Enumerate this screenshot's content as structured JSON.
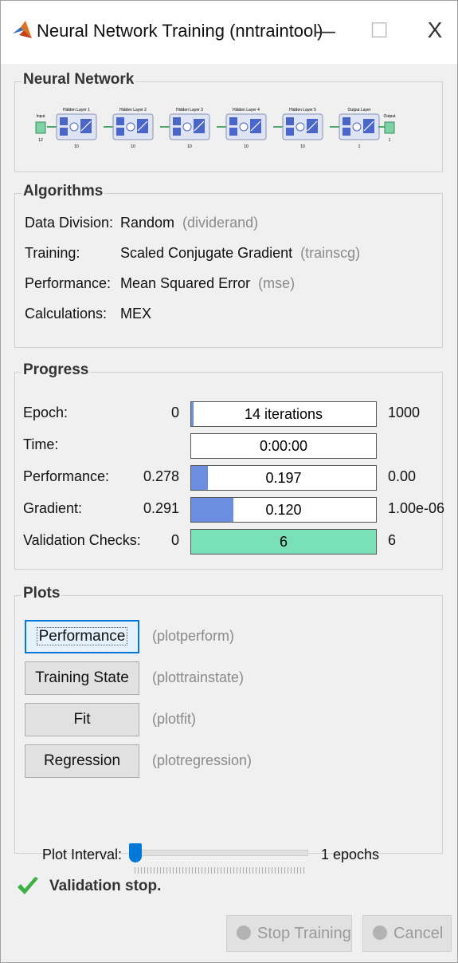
{
  "window": {
    "title": "Neural Network Training (nntraintool)",
    "minimize_glyph": "—",
    "maximize_glyph": "☐",
    "close_glyph": "X",
    "icon": "matlab-logo-icon"
  },
  "network": {
    "title": "Neural Network",
    "input_label": "Input",
    "input_size": "12",
    "output_label": "Output",
    "output_size": "1",
    "layers": [
      {
        "name": "Hidden Layer 1",
        "size": "10"
      },
      {
        "name": "Hidden Layer 2",
        "size": "10"
      },
      {
        "name": "Hidden Layer 3",
        "size": "10"
      },
      {
        "name": "Hidden Layer 4",
        "size": "10"
      },
      {
        "name": "Hidden Layer 5",
        "size": "10"
      },
      {
        "name": "Output Layer",
        "size": "1"
      }
    ],
    "w_label": "W",
    "b_label": "b"
  },
  "algorithms": {
    "title": "Algorithms",
    "rows": [
      {
        "label": "Data Division:",
        "value": "Random",
        "fn": "(dividerand)"
      },
      {
        "label": "Training:",
        "value": "Scaled Conjugate Gradient",
        "fn": "(trainscg)"
      },
      {
        "label": "Performance:",
        "value": "Mean Squared Error",
        "fn": "(mse)"
      },
      {
        "label": "Calculations:",
        "value": "MEX",
        "fn": ""
      }
    ]
  },
  "progress": {
    "title": "Progress",
    "rows": [
      {
        "label": "Epoch:",
        "min": "0",
        "text": "14 iterations",
        "max": "1000",
        "fill": 0.014,
        "color": "#6b8ee0"
      },
      {
        "label": "Time:",
        "min": "",
        "text": "0:00:00",
        "max": "",
        "fill": 0,
        "color": "#6b8ee0"
      },
      {
        "label": "Performance:",
        "min": "0.278",
        "text": "0.197",
        "max": "0.00",
        "fill": 0.09,
        "color": "#6b8ee0"
      },
      {
        "label": "Gradient:",
        "min": "0.291",
        "text": "0.120",
        "max": "1.00e-06",
        "fill": 0.23,
        "color": "#6b8ee0"
      },
      {
        "label": "Validation Checks:",
        "min": "0",
        "text": "6",
        "max": "6",
        "fill": 1.0,
        "color": "#79e0b8"
      }
    ]
  },
  "plots": {
    "title": "Plots",
    "buttons": [
      {
        "label": "Performance",
        "fn": "(plotperform)"
      },
      {
        "label": "Training State",
        "fn": "(plottrainstate)"
      },
      {
        "label": "Fit",
        "fn": "(plotfit)"
      },
      {
        "label": "Regression",
        "fn": "(plotregression)"
      }
    ],
    "interval_label": "Plot Interval:",
    "interval_value": "1 epochs",
    "interval_position": 0
  },
  "status": {
    "icon": "checkmark-icon",
    "text": "Validation stop.",
    "color": "#3cb043"
  },
  "footer": {
    "stop_label": "Stop Training",
    "cancel_label": "Cancel"
  }
}
